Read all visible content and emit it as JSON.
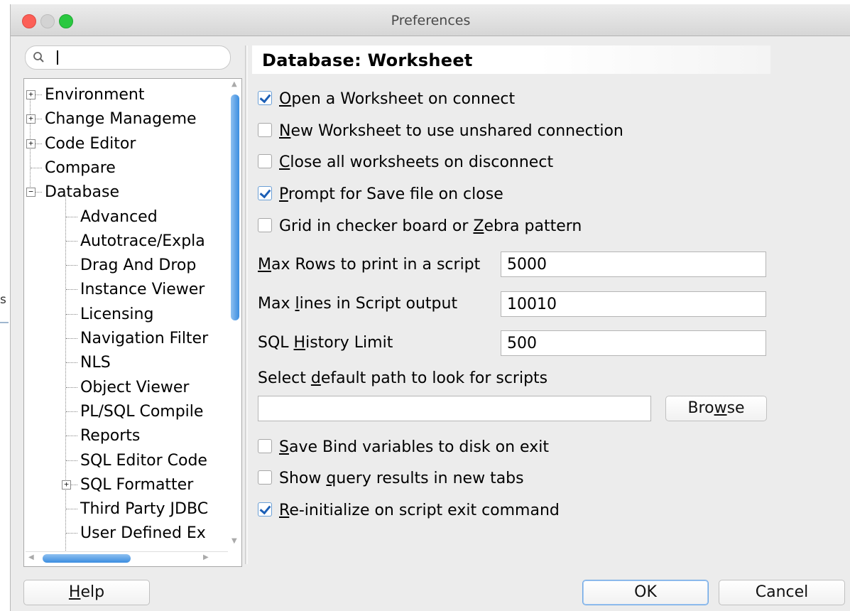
{
  "window": {
    "title": "Preferences"
  },
  "search": {
    "placeholder": "",
    "value": ""
  },
  "tree": {
    "items": [
      {
        "label": "Environment",
        "expander": "+"
      },
      {
        "label": "Change Manageme",
        "expander": "+"
      },
      {
        "label": "Code Editor",
        "expander": "+"
      },
      {
        "label": "Compare",
        "expander": ""
      },
      {
        "label": "Database",
        "expander": "−"
      },
      {
        "label": "Advanced",
        "expander": ""
      },
      {
        "label": "Autotrace/Expla",
        "expander": ""
      },
      {
        "label": "Drag And Drop",
        "expander": ""
      },
      {
        "label": "Instance Viewer",
        "expander": ""
      },
      {
        "label": "Licensing",
        "expander": ""
      },
      {
        "label": "Navigation Filter",
        "expander": ""
      },
      {
        "label": "NLS",
        "expander": ""
      },
      {
        "label": "Object Viewer",
        "expander": ""
      },
      {
        "label": "PL/SQL Compile",
        "expander": ""
      },
      {
        "label": "Reports",
        "expander": ""
      },
      {
        "label": "SQL Editor Code",
        "expander": ""
      },
      {
        "label": "SQL Formatter",
        "expander": "+"
      },
      {
        "label": "Third Party JDBC",
        "expander": ""
      },
      {
        "label": "User Defined Ex",
        "expander": ""
      }
    ]
  },
  "panel": {
    "heading": "Database: Worksheet",
    "checkboxes": [
      {
        "pre": "",
        "mnemonic": "O",
        "post": "pen a Worksheet on connect",
        "checked": true
      },
      {
        "pre": "",
        "mnemonic": "N",
        "post": "ew Worksheet to use unshared connection",
        "checked": false
      },
      {
        "pre": "",
        "mnemonic": "C",
        "post": "lose all worksheets on disconnect",
        "checked": false
      },
      {
        "pre": "",
        "mnemonic": "P",
        "post": "rompt for Save file on close",
        "checked": true
      },
      {
        "pre": "Grid in checker board or ",
        "mnemonic": "Z",
        "post": "ebra pattern",
        "checked": false
      }
    ],
    "fields": {
      "max_rows": {
        "pre": "",
        "mnemonic": "M",
        "post": "ax Rows to print in a script",
        "value": "5000"
      },
      "max_lines": {
        "pre": "Max ",
        "mnemonic": "l",
        "post": "ines in Script output",
        "value": "10010"
      },
      "history": {
        "pre": "SQL ",
        "mnemonic": "H",
        "post": "istory Limit",
        "value": "500"
      }
    },
    "path": {
      "pre": "Select ",
      "mnemonic": "d",
      "post": "efault path to look for scripts",
      "value": ""
    },
    "browse": {
      "pre": "Bro",
      "mnemonic": "w",
      "post": "se"
    },
    "checkboxes2": [
      {
        "pre": "",
        "mnemonic": "S",
        "post": "ave Bind variables to disk on exit",
        "checked": false
      },
      {
        "pre": "Show ",
        "mnemonic": "q",
        "post": "uery results in new tabs",
        "checked": false
      },
      {
        "pre": "",
        "mnemonic": "R",
        "post": "e-initialize on script exit command",
        "checked": true
      }
    ]
  },
  "footer": {
    "help": {
      "pre": "",
      "mnemonic": "H",
      "post": "elp"
    },
    "ok": "OK",
    "cancel": "Cancel"
  },
  "background_edge_text": "s"
}
